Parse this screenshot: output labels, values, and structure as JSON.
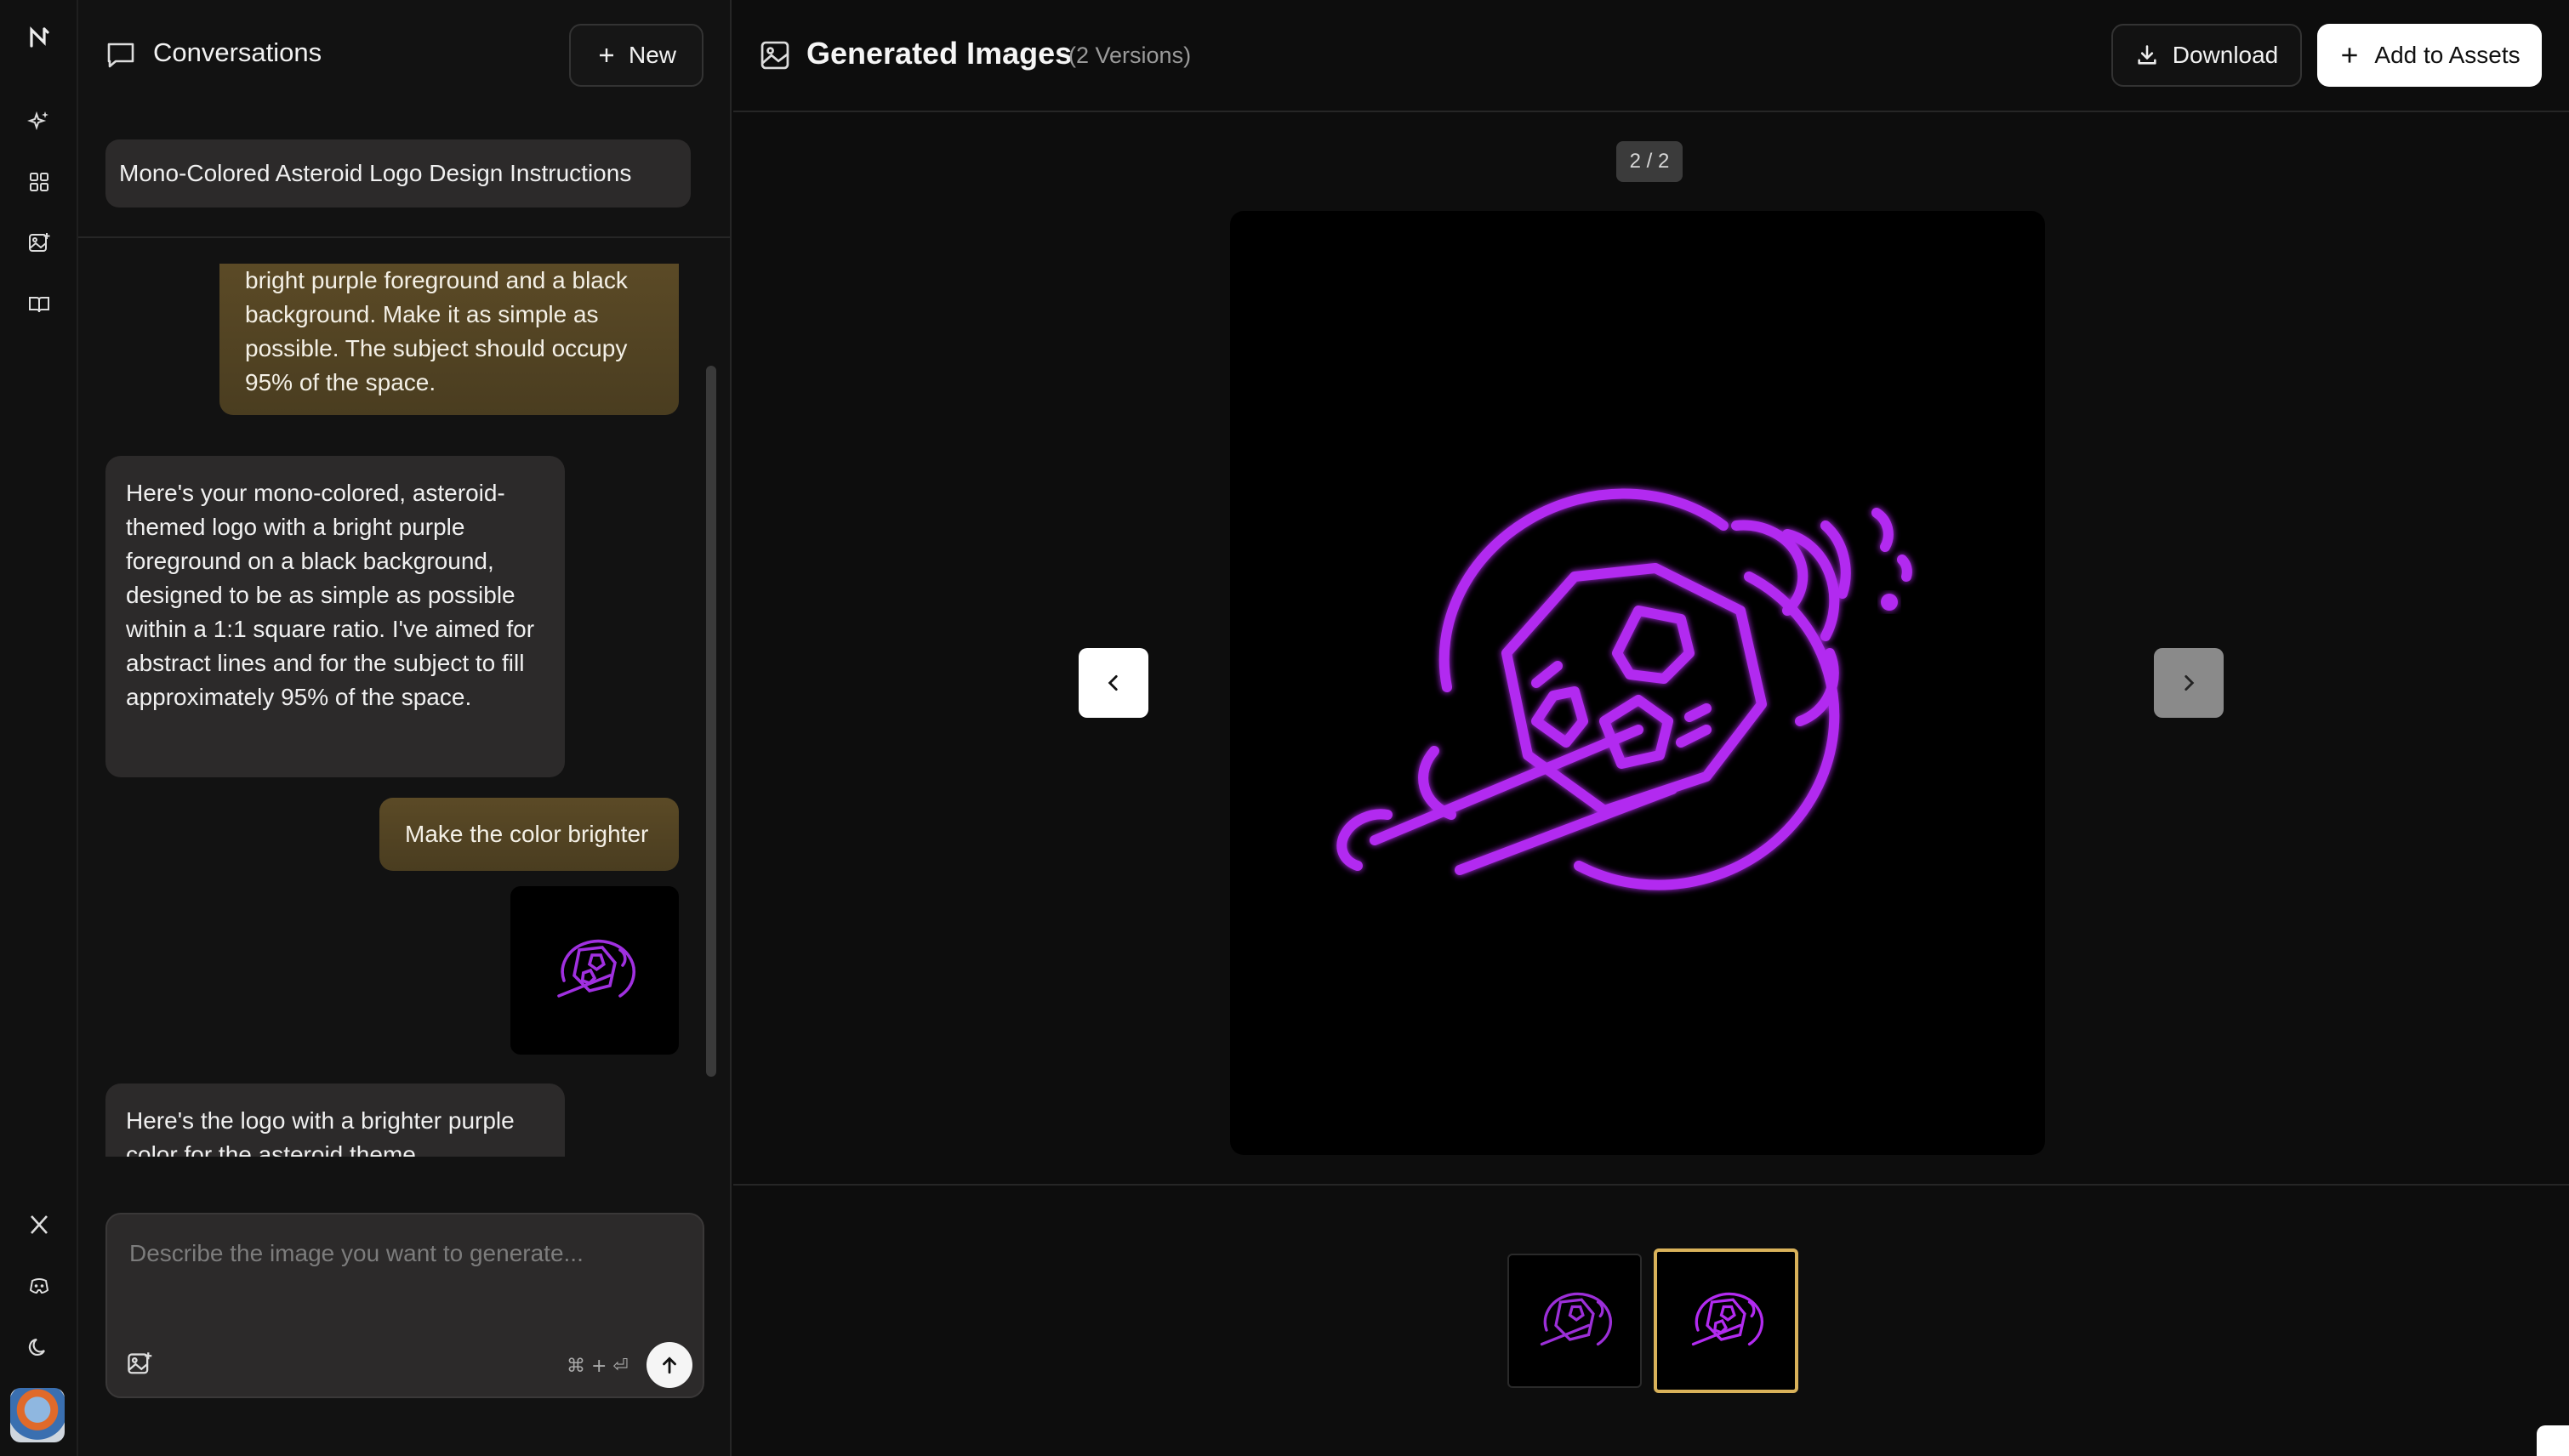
{
  "rail": {
    "logo": "N",
    "items": [
      "sparkle-icon",
      "grid-icon",
      "image-add-icon",
      "book-icon"
    ],
    "bottom_items": [
      "x-icon",
      "discord-icon",
      "moon-icon"
    ]
  },
  "conversations": {
    "title": "Conversations",
    "new_label": "New",
    "topic": "Mono-Colored Asteroid Logo Design Instructions"
  },
  "messages": {
    "user_1_lines": [
      "bright purple foreground and a black",
      "background. Make it as simple as",
      "possible. The subject should occupy",
      "95% of the space."
    ],
    "ai_1_lines": [
      "Here's your mono-colored, asteroid-",
      "themed logo with a bright purple",
      "foreground on a black background,",
      "designed to be as simple as possible",
      "within a 1:1 square ratio. I've aimed for",
      "abstract lines and for the subject to fill",
      "approximately 95% of the space."
    ],
    "user_2": "Make the color brighter",
    "ai_2_lines": [
      "Here's the logo with a brighter purple",
      "color for the asteroid theme"
    ]
  },
  "composer": {
    "placeholder": "Describe the image you want to generate...",
    "shortcut": "⌘ + ⏎"
  },
  "main": {
    "title": "Generated Images",
    "subtitle": "(2 Versions)",
    "download_label": "Download",
    "add_label": "Add to Assets",
    "counter": "2 / 2",
    "selected_version": 2
  },
  "colors": {
    "accent_purple": "#b22bf0",
    "user_bubble": "#5b4a26",
    "selected_border": "#d9b25a"
  }
}
